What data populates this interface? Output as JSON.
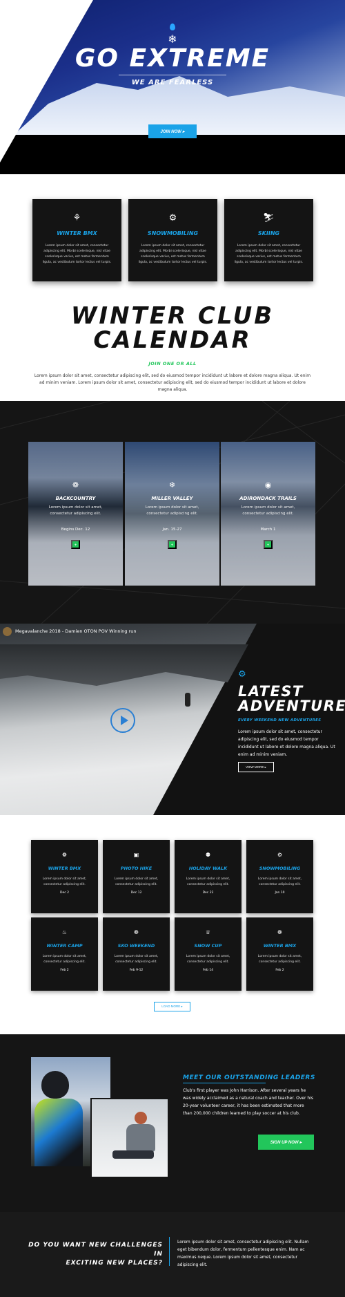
{
  "hero": {
    "title": "GO EXTREME",
    "subtitle": "WE ARE FEARLESS",
    "button": "JOIN NOW ▸"
  },
  "features": [
    {
      "icon": "bmx-icon",
      "glyph": "⚘",
      "title": "WINTER BMX",
      "desc": "Lorem ipsum dolor sit amet, consectetur adipiscing elit. Morbi scelerisque, nisl vitae scelerisque varius, est metus fermentum ligula, ac vestibulum tortor lectus vel turpis."
    },
    {
      "icon": "gear-icon",
      "glyph": "⚙",
      "title": "SNOWMOBILING",
      "desc": "Lorem ipsum dolor sit amet, consectetur adipiscing elit. Morbi scelerisque, nisl vitae scelerisque varius, est metus fermentum ligula, ac vestibulum tortor lectus vel turpis."
    },
    {
      "icon": "skier-icon",
      "glyph": "⛷",
      "title": "SKIING",
      "desc": "Lorem ipsum dolor sit amet, consectetur adipiscing elit. Morbi scelerisque, nisl vitae scelerisque varius, est metus fermentum ligula, ac vestibulum tortor lectus vel turpis."
    }
  ],
  "club": {
    "title_line1": "WINTER CLUB",
    "title_line2": "CALENDAR",
    "subtitle": "JOIN ONE OR ALL",
    "desc": "Lorem ipsum dolor sit amet, consectetur adipiscing elit, sed do eiusmod tempor incididunt ut labore et dolore magna aliqua. Ut enim ad minim veniam. Lorem ipsum dolor sit amet, consectetur adipiscing elit, sed do eiusmod tempor incididunt ut labore et dolore magna aliqua."
  },
  "calendar": [
    {
      "icon": "eagle-icon",
      "glyph": "❁",
      "title": "BACKCOUNTRY",
      "desc": "Lorem ipsum dolor sit amet, consectetur adipiscing elit.",
      "date": "Begins Dec. 12",
      "button": "+"
    },
    {
      "icon": "snowflake-icon",
      "glyph": "❄",
      "title": "MILLER VALLEY",
      "desc": "Lorem ipsum dolor sit amet, consectetur adipiscing elit.",
      "date": "Jan. 15-27",
      "button": "+"
    },
    {
      "icon": "target-icon",
      "glyph": "◉",
      "title": "ADIRONDACK TRAILS",
      "desc": "Lorem ipsum dolor sit amet, consectetur adipiscing elit.",
      "date": "March 1",
      "button": "+"
    }
  ],
  "video": {
    "title": "Megavalanche 2018 - Damien OTON POV Winning run"
  },
  "latest": {
    "title_line1": "LATEST",
    "title_line2": "ADVENTURE",
    "subtitle": "EVERY WEEKEND NEW ADVENTURES",
    "desc": "Lorem ipsum dolor sit amet, consectetur adipiscing elit, sed do eiusmod tempor incididunt ut labore et dolore magna aliqua. Ut enim ad minim veniam.",
    "button": "VIEW MORE ▸"
  },
  "events": [
    {
      "icon": "eagle-icon",
      "glyph": "❁",
      "title": "WINTER BMX",
      "desc": "Lorem ipsum dolor sit amet, consectetur adipiscing elit.",
      "date": "Dec 2"
    },
    {
      "icon": "camera-icon",
      "glyph": "▣",
      "title": "PHOTO HIKE",
      "desc": "Lorem ipsum dolor sit amet, consectetur adipiscing elit.",
      "date": "Dec 12"
    },
    {
      "icon": "hiker-icon",
      "glyph": "⚉",
      "title": "HOLIDAY WALK",
      "desc": "Lorem ipsum dolor sit amet, consectetur adipiscing elit.",
      "date": "Dec 22"
    },
    {
      "icon": "gear-icon",
      "glyph": "⚙",
      "title": "SNOWMOBILING",
      "desc": "Lorem ipsum dolor sit amet, consectetur adipiscing elit.",
      "date": "Jan 10"
    },
    {
      "icon": "fire-icon",
      "glyph": "♨",
      "title": "WINTER CAMP",
      "desc": "Lorem ipsum dolor sit amet, consectetur adipiscing elit.",
      "date": "Feb 2"
    },
    {
      "icon": "eagle-icon",
      "glyph": "❁",
      "title": "SKO WEEKEND",
      "desc": "Lorem ipsum dolor sit amet, consectetur adipiscing elit.",
      "date": "Feb 9-12"
    },
    {
      "icon": "trophy-icon",
      "glyph": "♕",
      "title": "SNOW CUP",
      "desc": "Lorem ipsum dolor sit amet, consectetur adipiscing elit.",
      "date": "Feb 14"
    },
    {
      "icon": "eagle-icon",
      "glyph": "❁",
      "title": "WINTER BMX",
      "desc": "Lorem ipsum dolor sit amet, consectetur adipiscing elit.",
      "date": "Feb 2"
    }
  ],
  "load_more": "LOAD MORE ▸",
  "leaders": {
    "title": "MEET OUR OUTSTANDING LEADERS",
    "desc": "Club's first player was John Harrison. After several years he was widely acclaimed as a natural coach and teacher. Over his 20-year volunteer career, it has been estimated that more than 200,000 children learned to play soccer at his club.",
    "button": "SIGN UP NOW ▸"
  },
  "cta": {
    "question_line1": "DO YOU WANT NEW CHALLENGES IN",
    "question_line2": "EXCITING NEW PLACES?",
    "desc": "Lorem ipsum dolor sit amet, consectetur adipiscing elit. Nullam eget bibendum dolor, fermentum pellentesque enim. Nam ac maximus neque. Lorem ipsum dolor sit amet, consectetur adipiscing elit."
  },
  "colors": {
    "accent_blue": "#1aa3e8",
    "accent_green": "#22c65b",
    "dark": "#151515"
  }
}
